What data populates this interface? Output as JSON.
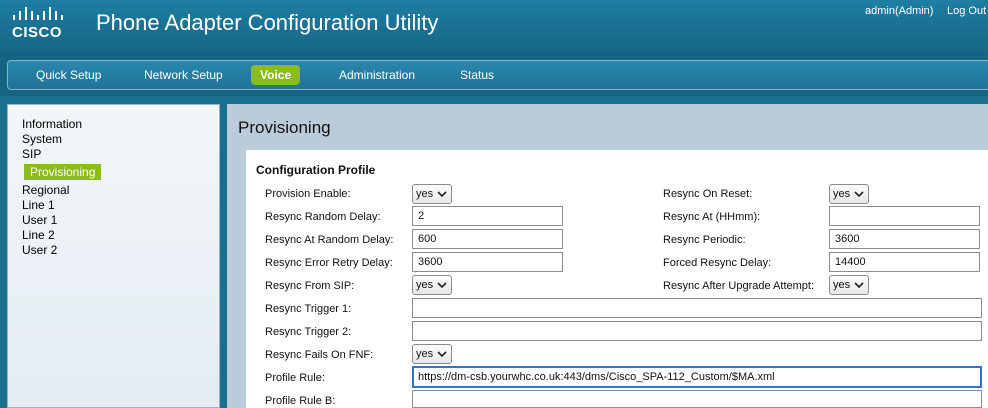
{
  "header": {
    "logo_text": "CISCO",
    "title": "Phone Adapter Configuration Utility",
    "user": "admin(Admin)",
    "logout": "Log Out"
  },
  "nav": {
    "tabs": [
      {
        "label": "Quick Setup"
      },
      {
        "label": "Network Setup"
      },
      {
        "label": "Voice"
      },
      {
        "label": "Administration"
      },
      {
        "label": "Status"
      }
    ],
    "active": "Voice"
  },
  "sidebar": {
    "items": [
      {
        "label": "Information"
      },
      {
        "label": "System"
      },
      {
        "label": "SIP"
      },
      {
        "label": "Provisioning"
      },
      {
        "label": "Regional"
      },
      {
        "label": "Line 1"
      },
      {
        "label": "User 1"
      },
      {
        "label": "Line 2"
      },
      {
        "label": "User 2"
      }
    ],
    "active": "Provisioning"
  },
  "page": {
    "title": "Provisioning",
    "section_title": "Configuration Profile"
  },
  "fields": {
    "provision_enable": {
      "label": "Provision Enable:",
      "value": "yes"
    },
    "resync_on_reset": {
      "label": "Resync On Reset:",
      "value": "yes"
    },
    "resync_random_delay": {
      "label": "Resync Random Delay:",
      "value": "2"
    },
    "resync_at": {
      "label": "Resync At (HHmm):",
      "value": ""
    },
    "resync_at_random_delay": {
      "label": "Resync At Random Delay:",
      "value": "600"
    },
    "resync_periodic": {
      "label": "Resync Periodic:",
      "value": "3600"
    },
    "resync_error_retry_delay": {
      "label": "Resync Error Retry Delay:",
      "value": "3600"
    },
    "forced_resync_delay": {
      "label": "Forced Resync Delay:",
      "value": "14400"
    },
    "resync_from_sip": {
      "label": "Resync From SIP:",
      "value": "yes"
    },
    "resync_after_upgrade": {
      "label": "Resync After Upgrade Attempt:",
      "value": "yes"
    },
    "resync_trigger_1": {
      "label": "Resync Trigger 1:",
      "value": ""
    },
    "resync_trigger_2": {
      "label": "Resync Trigger 2:",
      "value": ""
    },
    "resync_fails_on_fnf": {
      "label": "Resync Fails On FNF:",
      "value": "yes"
    },
    "profile_rule": {
      "label": "Profile Rule:",
      "value": "https://dm-csb.yourwhc.co.uk:443/dms/Cisco_SPA-112_Custom/$MA.xml"
    },
    "profile_rule_b": {
      "label": "Profile Rule B:",
      "value": ""
    }
  },
  "colors": {
    "header_bg": "#1a6f92",
    "nav_active": "#8bbb1f",
    "main_bg": "#bccbd9",
    "focus_border": "#2f73d6"
  },
  "icons": {
    "logo": "cisco-bars-logo",
    "select": "chevron-down-icon"
  }
}
